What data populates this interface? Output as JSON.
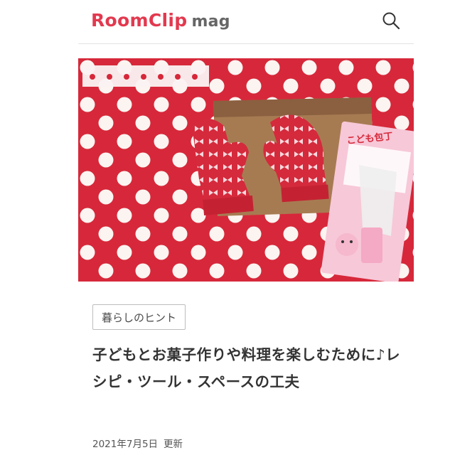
{
  "header": {
    "logo_main": "RoomClip",
    "logo_sub": "mag",
    "search_icon": "search-icon",
    "brand_color": "#e2394f"
  },
  "article": {
    "category": "暮らしのヒント",
    "title": "子どもとお菓子作りや料理を楽しむために♪レシピ・ツール・スペースの工夫",
    "date": "2021年7月5日",
    "date_suffix": "更新"
  },
  "hero": {
    "package_text": "こども包丁"
  }
}
